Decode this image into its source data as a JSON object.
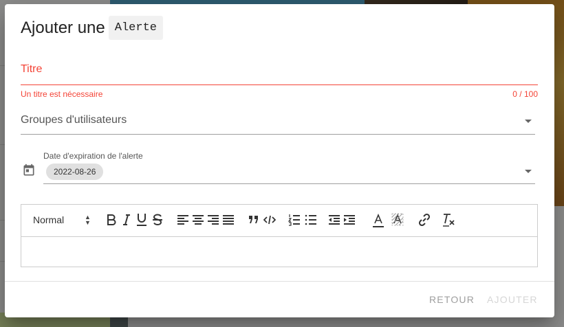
{
  "dialog": {
    "title_prefix": "Ajouter une",
    "title_code": "Alerte"
  },
  "form": {
    "title_field": {
      "label": "Titre",
      "value": "",
      "helper": "Un titre est nécessaire",
      "counter": "0 / 100",
      "error_color": "#f44336"
    },
    "groups_field": {
      "placeholder": "Groupes d'utilisateurs"
    },
    "expiry_field": {
      "label": "Date d'expiration de l'alerte",
      "chip_value": "2022-08-26",
      "icon": "calendar-icon"
    }
  },
  "editor": {
    "header_select": "Normal",
    "toolbar_icons": [
      "bold-icon",
      "italic-icon",
      "underline-icon",
      "strike-icon",
      "align-left-icon",
      "align-center-icon",
      "align-right-icon",
      "align-justify-icon",
      "blockquote-icon",
      "code-icon",
      "ordered-list-icon",
      "bullet-list-icon",
      "outdent-icon",
      "indent-icon",
      "text-color-icon",
      "background-color-icon",
      "link-icon",
      "clear-format-icon"
    ],
    "content": ""
  },
  "actions": {
    "back": "RETOUR",
    "add": "AJOUTER"
  }
}
